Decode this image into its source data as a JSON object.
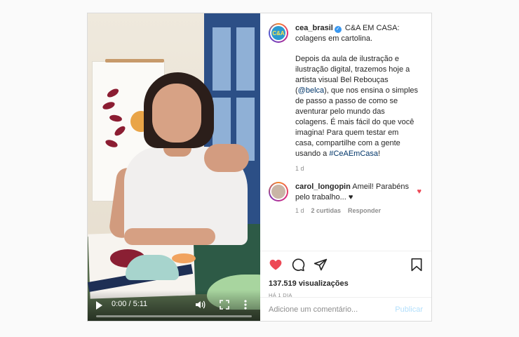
{
  "post": {
    "username": "cea_brasil",
    "avatar_text": "C&A",
    "caption_title": "C&A EM CASA: colagens em cartolina.",
    "caption_p1": "Depois da aula de ilustração e ilustração digital, trazemos hoje a artista visual Bel Rebouças (",
    "mention": "@belca",
    "caption_p2": "), que nos ensina o simples de passo a passo de como se aventurar pelo mundo das colagens. É mais fácil do que você imagina! Para quem testar em casa, compartilhe com a gente usando a ",
    "hashtag": "#CeAEmCasa",
    "caption_end": "!",
    "time": "1 d"
  },
  "comment": {
    "username": "carol_longopin",
    "text": "Ameil! Parabéns pelo trabalho... ♥",
    "time": "1 d",
    "likes": "2 curtidas",
    "reply": "Responder"
  },
  "video": {
    "time": "0:00 / 5:11",
    "progress": 0
  },
  "stats": {
    "views": "137.519 visualizações",
    "posted": "HÁ 1 DIA"
  },
  "composer": {
    "placeholder": "Adicione um comentário...",
    "publish": "Publicar"
  },
  "icons": {
    "like": "heart-filled-icon",
    "comment": "comment-icon",
    "share": "share-icon",
    "save": "bookmark-icon",
    "verified": "verified-badge-icon"
  },
  "colors": {
    "like": "#ed4956",
    "link": "#003569",
    "publish": "#b2dffc",
    "verified": "#3897f0"
  }
}
